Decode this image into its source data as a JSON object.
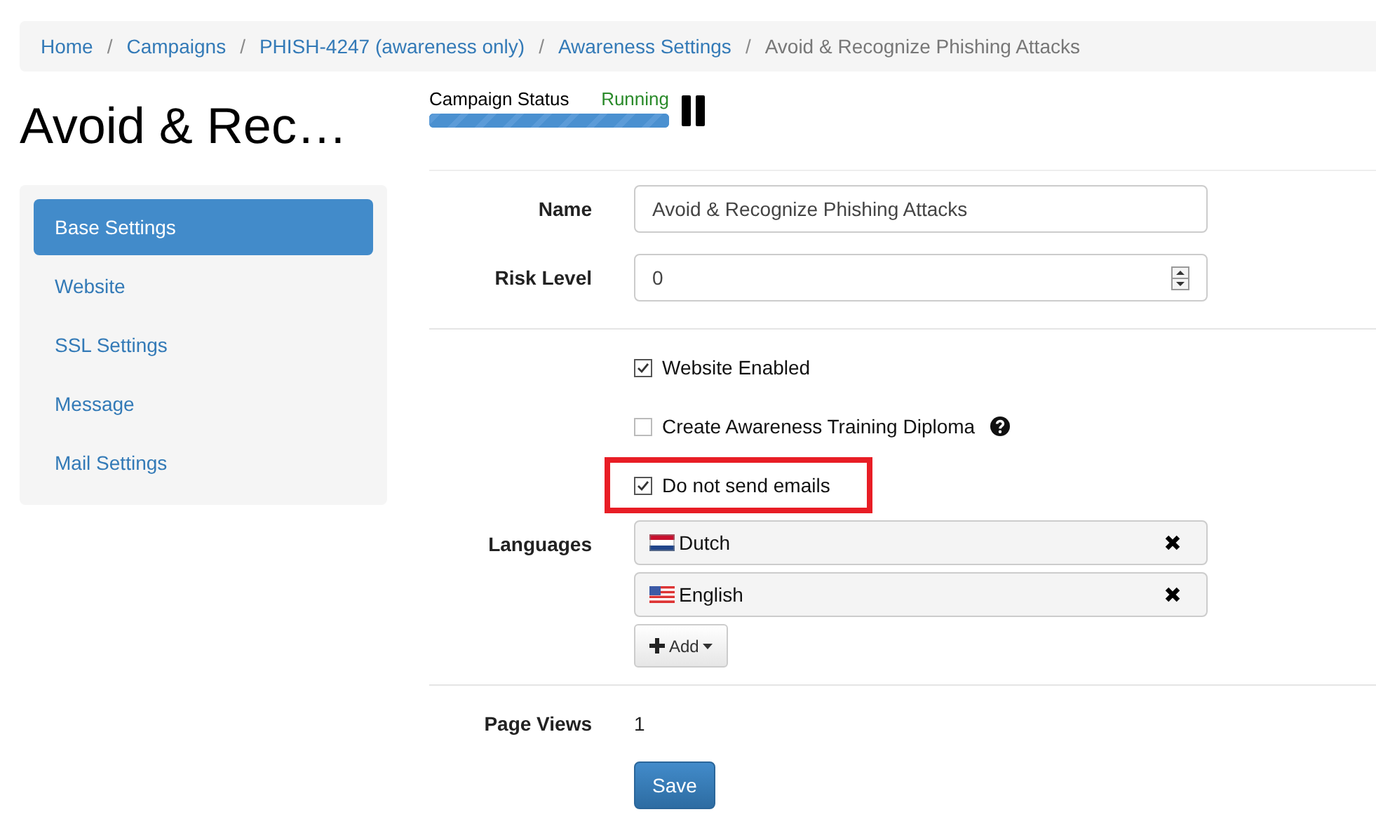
{
  "breadcrumb": [
    {
      "label": "Home",
      "current": false
    },
    {
      "label": "Campaigns",
      "current": false
    },
    {
      "label": "PHISH-4247 (awareness only)",
      "current": false
    },
    {
      "label": "Awareness Settings",
      "current": false
    },
    {
      "label": "Avoid & Recognize Phishing Attacks",
      "current": true
    }
  ],
  "separator": "/",
  "page_title": "Avoid & Rec…",
  "campaign_status": {
    "label": "Campaign Status",
    "value": "Running",
    "level": 1
  },
  "sidebar": {
    "items": [
      {
        "label": "Base Settings",
        "selected": true
      },
      {
        "label": "Website",
        "selected": false
      },
      {
        "label": "SSL Settings",
        "selected": false
      },
      {
        "label": "Message",
        "selected": false
      },
      {
        "label": "Mail Settings",
        "selected": false
      }
    ]
  },
  "fields": [
    {
      "label": "Name",
      "kind": "text",
      "value": "Avoid & Recognize Phishing Attacks"
    },
    {
      "label": "Risk Level",
      "kind": "number",
      "value": "0"
    }
  ],
  "checkboxes": [
    {
      "label": "Website Enabled",
      "kind": "plain",
      "checked": true,
      "highlighted": false
    },
    {
      "label": "Create Awareness Training Diploma",
      "kind": "with_help",
      "checked": false,
      "highlighted": false
    },
    {
      "label": "Do not send emails",
      "kind": "plain",
      "checked": true,
      "highlighted": true
    }
  ],
  "languages": {
    "label": "Languages",
    "items": [
      {
        "name": "Dutch",
        "kind": "nl"
      },
      {
        "name": "English",
        "kind": "us"
      }
    ],
    "add_button": "Add"
  },
  "page_views": {
    "label": "Page Views",
    "value": "1"
  },
  "save_button": "Save"
}
